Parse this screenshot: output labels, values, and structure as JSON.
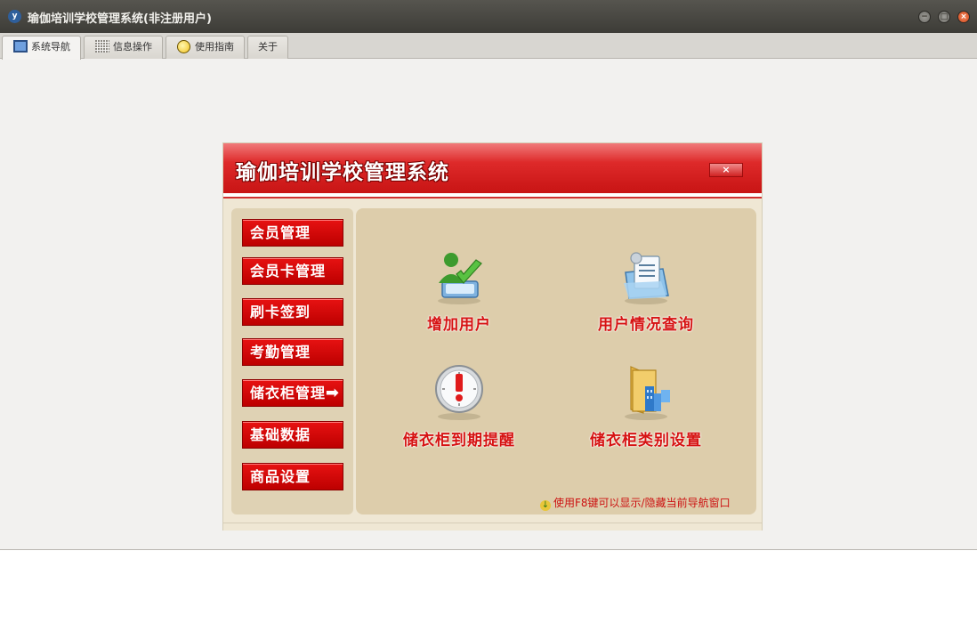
{
  "window": {
    "icon_text": "y",
    "title": "瑜伽培训学校管理系统(非注册用户)",
    "controls": {
      "minimize": "−",
      "maximize": "□",
      "close": "×"
    }
  },
  "tabs": [
    {
      "label": "系统导航",
      "icon": "monitor-icon",
      "active": true
    },
    {
      "label": "信息操作",
      "icon": "grid-icon",
      "active": false
    },
    {
      "label": "使用指南",
      "icon": "help-icon",
      "active": false
    },
    {
      "label": "关于",
      "icon": "",
      "active": false
    }
  ],
  "nav": {
    "title": "瑜伽培训学校管理系统",
    "close_label": "×",
    "menu": [
      "会员管理",
      "会员卡管理",
      "刷卡签到",
      "考勤管理",
      "储衣柜管理",
      "基础数据",
      "商品设置"
    ],
    "menu_arrow": "➡",
    "actions": [
      {
        "label": "增加用户",
        "icon": "add-user-icon"
      },
      {
        "label": "用户情况查询",
        "icon": "query-user-icon"
      },
      {
        "label": "储衣柜到期提醒",
        "icon": "clock-alert-icon"
      },
      {
        "label": "储衣柜类别设置",
        "icon": "folder-settings-icon"
      }
    ],
    "hint": "使用F8键可以显示/隐藏当前导航窗口"
  },
  "colors": {
    "header_red": "#de2a2a",
    "menu_red": "#e71212",
    "action_text": "#d61313",
    "panel_bg": "#ddcdab"
  }
}
